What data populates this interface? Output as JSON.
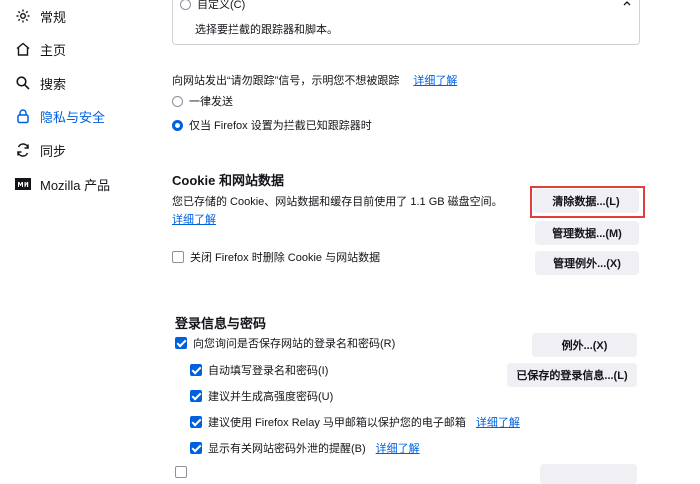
{
  "sidebar": {
    "items": [
      {
        "label": "常规",
        "icon": "gear-icon"
      },
      {
        "label": "主页",
        "icon": "home-icon"
      },
      {
        "label": "搜索",
        "icon": "search-icon"
      },
      {
        "label": "隐私与安全",
        "icon": "lock-icon",
        "active": true
      },
      {
        "label": "同步",
        "icon": "sync-icon"
      },
      {
        "label": "Mozilla 产品",
        "icon": "mozilla-icon"
      }
    ]
  },
  "custom_option": {
    "label": "自定义(C)",
    "description": "选择要拦截的跟踪器和脚本。"
  },
  "dnt": {
    "text": "向网站发出“请勿跟踪”信号，示明您不想被跟踪",
    "learn_more": "详细了解",
    "options": [
      {
        "label": "一律发送",
        "checked": false
      },
      {
        "label": "仅当 Firefox 设置为拦截已知跟踪器时",
        "checked": true
      }
    ]
  },
  "cookies": {
    "title": "Cookie 和网站数据",
    "description": "您已存储的 Cookie、网站数据和缓存目前使用了 1.1 GB 磁盘空间。",
    "learn_more": "详细了解",
    "delete_on_close": "关闭 Firefox 时删除 Cookie 与网站数据",
    "buttons": {
      "clear": "清除数据...(L)",
      "manage": "管理数据...(M)",
      "exceptions": "管理例外...(X)"
    }
  },
  "logins": {
    "title": "登录信息与密码",
    "ask_save": "向您询问是否保存网站的登录名和密码(R)",
    "autofill": "自动填写登录名和密码(I)",
    "suggest_strong": "建议并生成高强度密码(U)",
    "relay": "建议使用 Firefox Relay 马甲邮箱以保护您的电子邮箱",
    "relay_learn_more": "详细了解",
    "breach_alerts": "显示有关网站密码外泄的提醒(B)",
    "breach_learn_more": "详细了解",
    "buttons": {
      "exceptions": "例外...(X)",
      "saved_logins": "已保存的登录信息...(L)"
    }
  },
  "colors": {
    "accent": "#0061e0",
    "highlight": "#e03d3d"
  }
}
